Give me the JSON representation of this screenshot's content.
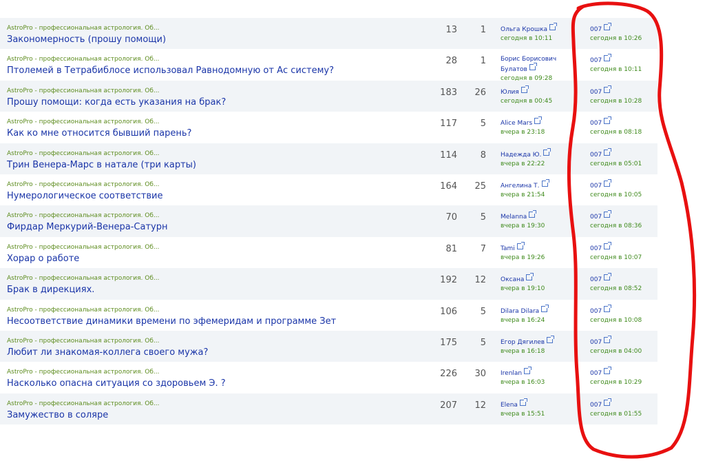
{
  "colors": {
    "forum_link": "#5d8c1e",
    "topic_title": "#1a35a8",
    "time": "#3f8a1c",
    "annotation": "#e81010",
    "row_shade": "#f1f4f7"
  },
  "topics": [
    {
      "forum": "AstroPro - профессиональная астрология. Об...",
      "title": "Закономерность (прошу помощи)",
      "views": "13",
      "replies": "1",
      "poster": "Ольга Крошка",
      "poster_time": "сегодня в 10:11",
      "last_poster": "007",
      "last_time": "сегодня в 10:26"
    },
    {
      "forum": "AstroPro - профессиональная астрология. Об...",
      "title": "Птолемей в Тетрабиблосе использовал Равнодомную от Ас систему?",
      "views": "28",
      "replies": "1",
      "poster": "Борис Борисович Булатов",
      "poster_time": "сегодня в 09:28",
      "last_poster": "007",
      "last_time": "сегодня в 10:11"
    },
    {
      "forum": "AstroPro - профессиональная астрология. Об...",
      "title": "Прошу помощи: когда есть указания на брак?",
      "views": "183",
      "replies": "26",
      "poster": "Юлия",
      "poster_time": "сегодня в 00:45",
      "last_poster": "007",
      "last_time": "сегодня в 10:28"
    },
    {
      "forum": "AstroPro - профессиональная астрология. Об...",
      "title": "Как ко мне относится бывший парень?",
      "views": "117",
      "replies": "5",
      "poster": "Alice Mars",
      "poster_time": "вчера в 23:18",
      "last_poster": "007",
      "last_time": "сегодня в 08:18"
    },
    {
      "forum": "AstroPro - профессиональная астрология. Об...",
      "title": "Трин Венера-Марс в натале (три карты)",
      "views": "114",
      "replies": "8",
      "poster": "Надежда Ю.",
      "poster_time": "вчера в 22:22",
      "last_poster": "007",
      "last_time": "сегодня в 05:01"
    },
    {
      "forum": "AstroPro - профессиональная астрология. Об...",
      "title": "Нумерологическое соответствие",
      "views": "164",
      "replies": "25",
      "poster": "Ангелина Т.",
      "poster_time": "вчера в 21:54",
      "last_poster": "007",
      "last_time": "сегодня в 10:05"
    },
    {
      "forum": "AstroPro - профессиональная астрология. Об...",
      "title": "Фирдар Меркурий-Венера-Сатурн",
      "views": "70",
      "replies": "5",
      "poster": "Melanna",
      "poster_time": "вчера в 19:30",
      "last_poster": "007",
      "last_time": "сегодня в 08:36"
    },
    {
      "forum": "AstroPro - профессиональная астрология. Об...",
      "title": "Хорар о работе",
      "views": "81",
      "replies": "7",
      "poster": "Tami",
      "poster_time": "вчера в 19:26",
      "last_poster": "007",
      "last_time": "сегодня в 10:07"
    },
    {
      "forum": "AstroPro - профессиональная астрология. Об...",
      "title": "Брак в дирекциях.",
      "views": "192",
      "replies": "12",
      "poster": "Оксана",
      "poster_time": "вчера в 19:10",
      "last_poster": "007",
      "last_time": "сегодня в 08:52"
    },
    {
      "forum": "AstroPro - профессиональная астрология. Об...",
      "title": "Несоответствие динамики времени по эфемеридам и программе Зет",
      "views": "106",
      "replies": "5",
      "poster": "Dilara Dilara",
      "poster_time": "вчера в 16:24",
      "last_poster": "007",
      "last_time": "сегодня в 10:08"
    },
    {
      "forum": "AstroPro - профессиональная астрология. Об...",
      "title": "Любит ли знакомая-коллега своего мужа?",
      "views": "175",
      "replies": "5",
      "poster": "Егор Дягилев",
      "poster_time": "вчера в 16:18",
      "last_poster": "007",
      "last_time": "сегодня в 04:00"
    },
    {
      "forum": "AstroPro - профессиональная астрология. Об...",
      "title": "Насколько опасна ситуация со здоровьем Э. ?",
      "views": "226",
      "replies": "30",
      "poster": "Irenlan",
      "poster_time": "вчера в 16:03",
      "last_poster": "007",
      "last_time": "сегодня в 10:29"
    },
    {
      "forum": "AstroPro - профессиональная астрология. Об...",
      "title": "Замужество в соляре",
      "views": "207",
      "replies": "12",
      "poster": "Elena",
      "poster_time": "вчера в 15:51",
      "last_poster": "007",
      "last_time": "сегодня в 01:55"
    }
  ]
}
